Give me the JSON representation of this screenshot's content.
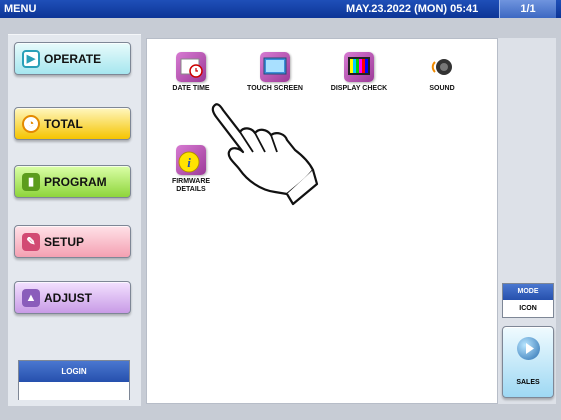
{
  "header": {
    "title": "MENU",
    "datetime": "MAY.23.2022 (MON)  05:41",
    "page": "1/1"
  },
  "sidebar": {
    "items": [
      {
        "label": "OPERATE",
        "icon": "operate-icon"
      },
      {
        "label": "TOTAL",
        "icon": "total-icon"
      },
      {
        "label": "PROGRAM",
        "icon": "program-icon"
      },
      {
        "label": "SETUP",
        "icon": "setup-icon"
      },
      {
        "label": "ADJUST",
        "icon": "adjust-icon"
      }
    ],
    "login_label": "LOGIN",
    "login_value": ""
  },
  "tiles": [
    {
      "label": "DATE TIME",
      "icon": "date-time-icon"
    },
    {
      "label": "TOUCH SCREEN",
      "icon": "touch-screen-icon"
    },
    {
      "label": "DISPLAY CHECK",
      "icon": "display-check-icon"
    },
    {
      "label": "SOUND",
      "icon": "sound-icon"
    },
    {
      "label": "FIRMWARE DETAILS",
      "icon": "firmware-details-icon"
    }
  ],
  "mode": {
    "title": "MODE",
    "value": "ICON"
  },
  "sales_label": "SALES"
}
